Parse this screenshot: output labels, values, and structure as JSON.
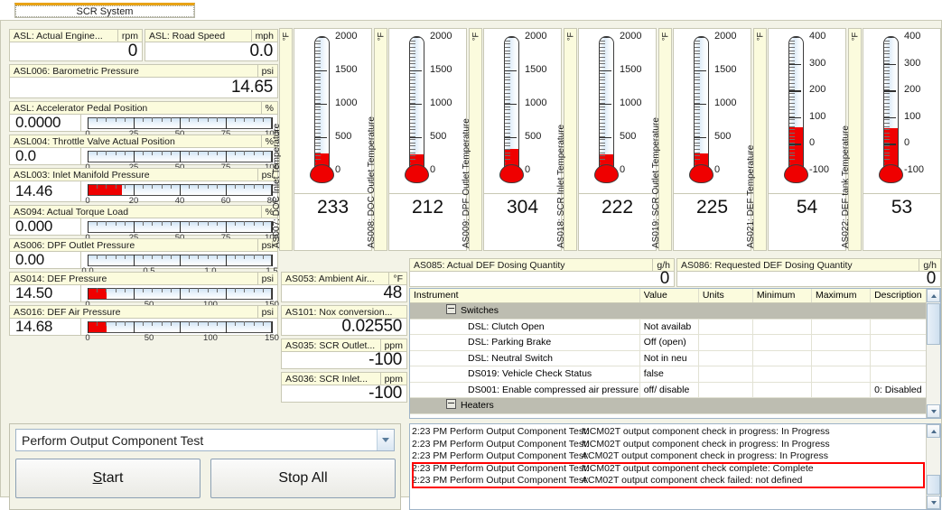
{
  "tab": {
    "label": "SCR System"
  },
  "left_cells": [
    {
      "name": "ASL: Actual Engine...",
      "unit": "rpm",
      "value": "0",
      "type": "plain"
    },
    {
      "name": "ASL: Road Speed",
      "unit": "mph",
      "value": "0.0",
      "type": "plain"
    },
    {
      "name": "ASL006: Barometric Pressure",
      "unit": "psi",
      "value": "14.65",
      "type": "plain"
    },
    {
      "name": "ASL: Accelerator Pedal Position",
      "unit": "%",
      "value": "0.0000",
      "type": "bar",
      "scale": {
        "min": 0,
        "max": 100,
        "labels": [
          "0",
          "25",
          "50",
          "75",
          "100"
        ],
        "fill": 0
      }
    },
    {
      "name": "ASL004: Throttle Valve Actual Position",
      "unit": "%",
      "value": "0.0",
      "type": "bar",
      "scale": {
        "min": 0,
        "max": 100,
        "labels": [
          "0",
          "25",
          "50",
          "75",
          "100"
        ],
        "fill": 0
      }
    },
    {
      "name": "ASL003: Inlet Manifold Pressure",
      "unit": "psi",
      "value": "14.46",
      "type": "bar",
      "scale": {
        "min": 0,
        "max": 80,
        "labels": [
          "0",
          "20",
          "40",
          "60",
          "80"
        ],
        "fill": 14.46
      }
    },
    {
      "name": "AS094: Actual Torque Load",
      "unit": "%",
      "value": "0.000",
      "type": "bar",
      "scale": {
        "min": 0,
        "max": 100,
        "labels": [
          "0",
          "25",
          "50",
          "75",
          "100"
        ],
        "fill": 0
      }
    },
    {
      "name": "AS006: DPF Outlet Pressure",
      "unit": "psi",
      "value": "0.00",
      "type": "bar",
      "scale": {
        "min": 0,
        "max": 1.5,
        "labels": [
          "0.0",
          "0.5",
          "1.0",
          "1.5"
        ],
        "fill": 0
      }
    },
    {
      "name": "AS014: DEF Pressure",
      "unit": "psi",
      "value": "14.50",
      "type": "bar",
      "scale": {
        "min": 0,
        "max": 150,
        "labels": [
          "0",
          "50",
          "100",
          "150"
        ],
        "fill": 14.5
      }
    },
    {
      "name": "AS016: DEF Air Pressure",
      "unit": "psi",
      "value": "14.68",
      "type": "bar",
      "scale": {
        "min": 0,
        "max": 150,
        "labels": [
          "0",
          "50",
          "100",
          "150"
        ],
        "fill": 14.68
      }
    }
  ],
  "mid_cells": [
    {
      "name": "AS053: Ambient Air...",
      "unit": "°F",
      "value": "48"
    },
    {
      "name": "AS101: Nox conversion...",
      "unit": "",
      "value": "0.02550"
    },
    {
      "name": "AS035: SCR Outlet...",
      "unit": "ppm",
      "value": "-100"
    },
    {
      "name": "AS036: SCR Inlet...",
      "unit": "ppm",
      "value": "-100"
    }
  ],
  "dosing_cells": [
    {
      "name": "AS085: Actual DEF Dosing Quantity",
      "unit": "g/h",
      "value": "0"
    },
    {
      "name": "AS086: Requested DEF Dosing Quantity",
      "unit": "g/h",
      "value": "0"
    }
  ],
  "thermometers": [
    {
      "label": "AS007: DOC Inlet Temperature",
      "unit": "°F",
      "reading": "233",
      "min": 0,
      "max": 2000,
      "ticks": [
        "2000",
        "1500",
        "1000",
        "500",
        "0"
      ],
      "value": 233
    },
    {
      "label": "AS008: DOC Outlet Temperature",
      "unit": "°F",
      "reading": "212",
      "min": 0,
      "max": 2000,
      "ticks": [
        "2000",
        "1500",
        "1000",
        "500",
        "0"
      ],
      "value": 212
    },
    {
      "label": "AS009: DPF Outlet Temperature",
      "unit": "°F",
      "reading": "304",
      "min": 0,
      "max": 2000,
      "ticks": [
        "2000",
        "1500",
        "1000",
        "500",
        "0"
      ],
      "value": 304
    },
    {
      "label": "AS018: SCR Inlet Temperature",
      "unit": "°F",
      "reading": "222",
      "min": 0,
      "max": 2000,
      "ticks": [
        "2000",
        "1500",
        "1000",
        "500",
        "0"
      ],
      "value": 222
    },
    {
      "label": "AS019: SCR Outlet Temperature",
      "unit": "°F",
      "reading": "225",
      "min": 0,
      "max": 2000,
      "ticks": [
        "2000",
        "1500",
        "1000",
        "500",
        "0"
      ],
      "value": 225
    },
    {
      "label": "AS021: DEF Temperature",
      "unit": "°F",
      "reading": "54",
      "min": -100,
      "max": 400,
      "ticks": [
        "400",
        "300",
        "200",
        "100",
        "0",
        "-100"
      ],
      "value": 54
    },
    {
      "label": "AS022: DEF tank Temperature",
      "unit": "°F",
      "reading": "53",
      "min": -100,
      "max": 400,
      "ticks": [
        "400",
        "300",
        "200",
        "100",
        "0",
        "-100"
      ],
      "value": 53
    }
  ],
  "table": {
    "columns": [
      "Instrument",
      "Value",
      "Units",
      "Minimum",
      "Maximum",
      "Description"
    ],
    "rows": [
      {
        "group": true,
        "instrument": "Switches"
      },
      {
        "group": false,
        "instrument": "DSL: Clutch Open",
        "value": "Not availab",
        "units": "",
        "minimum": "",
        "maximum": "",
        "description": ""
      },
      {
        "group": false,
        "instrument": "DSL: Parking Brake",
        "value": "Off (open)",
        "units": "",
        "minimum": "",
        "maximum": "",
        "description": ""
      },
      {
        "group": false,
        "instrument": "DSL: Neutral Switch",
        "value": "Not in neu",
        "units": "",
        "minimum": "",
        "maximum": "",
        "description": ""
      },
      {
        "group": false,
        "instrument": "DS019: Vehicle Check Status",
        "value": "false",
        "units": "",
        "minimum": "",
        "maximum": "",
        "description": ""
      },
      {
        "group": false,
        "instrument": "DS001: Enable compressed air pressure",
        "value": "off/ disable",
        "units": "",
        "minimum": "",
        "maximum": "",
        "description": "0: Disabled"
      },
      {
        "group": true,
        "instrument": "Heaters"
      }
    ]
  },
  "controls": {
    "selected_test": "Perform Output Component Test",
    "start_label": "Start",
    "start_accel": "S",
    "stop_label": "Stop All"
  },
  "log": {
    "entries": [
      {
        "time": "2:23 PM",
        "source": "Perform Output Component Test:",
        "message": "MCM02T output component check in progress: In Progress",
        "highlight": false
      },
      {
        "time": "2:23 PM",
        "source": "Perform Output Component Test:",
        "message": "MCM02T output component check in progress: In Progress",
        "highlight": false
      },
      {
        "time": "2:23 PM",
        "source": "Perform Output Component Test:",
        "message": "ACM02T output component check in progress: In Progress",
        "highlight": false
      },
      {
        "time": "2:23 PM",
        "source": "Perform Output Component Test:",
        "message": "MCM02T output component check complete: Complete",
        "highlight": true
      },
      {
        "time": "2:23 PM",
        "source": "Perform Output Component Test:",
        "message": "ACM02T output component check failed: not defined",
        "highlight": true
      }
    ]
  },
  "colors": {
    "header_bg": "#fbfbdd",
    "gauge_fill": "#ef0000",
    "group_row": "#bdbdb1",
    "tab_accent": "#e8a317",
    "highlight_border": "#ff0000"
  }
}
